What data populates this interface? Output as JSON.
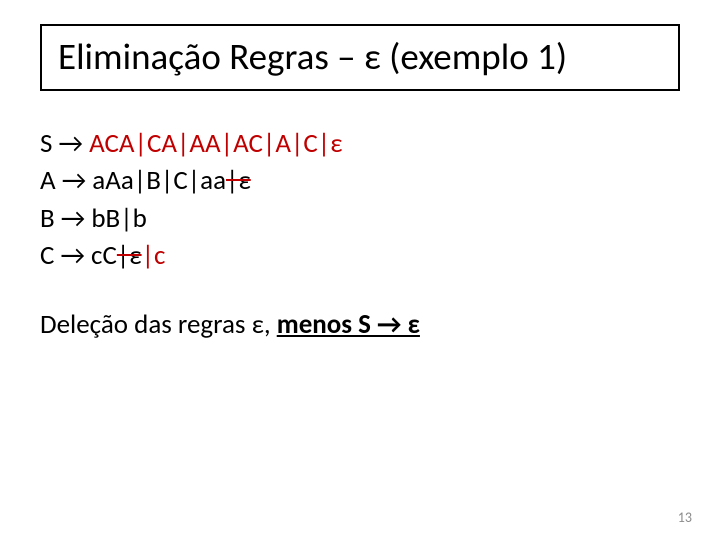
{
  "title": "Eliminação Regras – ε (exemplo 1)",
  "rules": {
    "s": {
      "lhs": "S → ",
      "added": "ACA|CA|AA|AC|A|C|ε"
    },
    "a": {
      "lhs": "A → ",
      "rhs": "aAa|B|C|aa",
      "del": "|ε"
    },
    "b": {
      "lhs": "B → ",
      "rhs": "bB|b"
    },
    "c": {
      "lhs": "C → ",
      "rhs": "cC",
      "del": "|ε",
      "added": "|c"
    }
  },
  "deletion": {
    "prefix": "Deleção das regras ε, ",
    "emph": "menos S → ε"
  },
  "page_number": "13"
}
